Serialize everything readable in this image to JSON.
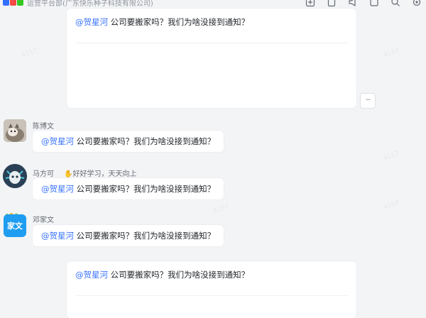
{
  "header": {
    "group_subtitle": "运营平台部(广东快乐种子科技有限公司)"
  },
  "toolbar": {
    "icons": [
      "add-member-icon",
      "document-icon",
      "announcement-icon",
      "pin-icon",
      "search-icon",
      "settings-icon"
    ]
  },
  "messages": [
    {
      "sender": "",
      "mention": "@贺星河",
      "text": "公司要搬家吗？我们为啥没接到通知？"
    },
    {
      "sender": "陈博文",
      "mention": "@贺星河",
      "text": "公司要搬家吗？我们为啥没接到通知？"
    },
    {
      "sender": "马方可",
      "status": "好好学习，天天向上",
      "mention": "@贺星河",
      "text": "公司要搬家吗？我们为啥没接到通知？"
    },
    {
      "sender": "邓家文",
      "avatar_text": "家文",
      "mention": "@贺星河",
      "text": "公司要搬家吗？我们为啥没接到通知？"
    },
    {
      "sender": "",
      "mention": "@贺星河",
      "text": "公司要搬家吗？我们为啥没接到通知？"
    }
  ],
  "more_button_label": "···",
  "colors": {
    "mention": "#3370ff",
    "background": "#f3f4f6",
    "bubble": "#ffffff",
    "avatar_blue": "#1e9df1"
  }
}
